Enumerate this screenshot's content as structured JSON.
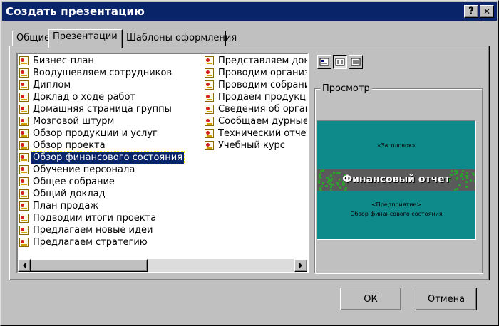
{
  "window": {
    "title": "Создать презентацию",
    "help_label": "?",
    "close_label": "✕"
  },
  "tabs": [
    {
      "label": "Общие",
      "active": false
    },
    {
      "label": "Презентации",
      "active": true
    },
    {
      "label": "Шаблоны оформления",
      "active": false
    }
  ],
  "list": {
    "column1": [
      "Бизнес-план",
      "Воодушевляем сотрудников",
      "Диплом",
      "Доклад о ходе работ",
      "Домашняя страница группы",
      "Мозговой штурм",
      "Обзор продукции и услуг",
      "Обзор проекта",
      "Обзор финансового состояния",
      "Обучение персонала",
      "Общее собрание",
      "Общий доклад",
      "План продаж",
      "Подводим итоги проекта",
      "Предлагаем новые идеи",
      "Предлагаем стратегию"
    ],
    "column2": [
      "Представляем доклад",
      "Проводим организаци",
      "Проводим собрание",
      "Продаем продукцию и",
      "Сведения об организа",
      "Сообщаем дурные нов",
      "Технический отчет",
      "Учебный курс"
    ],
    "selected": "Обзор финансового состояния"
  },
  "view_buttons": [
    {
      "icon": "large-icons-view-icon",
      "pressed": false
    },
    {
      "icon": "list-view-icon",
      "pressed": true
    },
    {
      "icon": "details-view-icon",
      "pressed": false
    }
  ],
  "preview": {
    "label": "Просмотр",
    "slide": {
      "top_text": "«Заголовок»",
      "title": "Финансовый отчет",
      "company": "<Предприятие>",
      "subtitle": "Обзор финансового состояния",
      "colors": {
        "background": "#0f8a8a",
        "band": "#5a5a5a",
        "speckle": "#2ca02c"
      }
    }
  },
  "buttons": {
    "ok": "ОК",
    "cancel": "Отмена"
  },
  "colors": {
    "titlebar": "#0a246a",
    "selection": "#0a246a",
    "face": "#c0c0c0"
  }
}
